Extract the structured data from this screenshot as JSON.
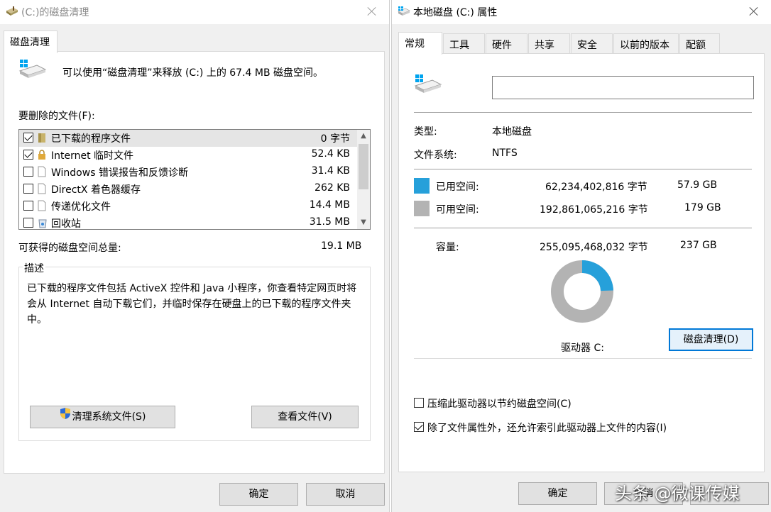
{
  "left": {
    "title": "(C:)的磁盘清理",
    "tab": "磁盘清理",
    "summary": "可以使用“磁盘清理”来释放  (C:) 上的 67.4 MB 磁盘空间。",
    "files_label": "要删除的文件(F):",
    "files": [
      {
        "name": "已下载的程序文件",
        "size": "0 字节",
        "checked": true,
        "icon": "folder-icon"
      },
      {
        "name": "Internet 临时文件",
        "size": "52.4 KB",
        "checked": true,
        "icon": "lock-icon"
      },
      {
        "name": "Windows 错误报告和反馈诊断",
        "size": "31.4 KB",
        "checked": false,
        "icon": "file-icon"
      },
      {
        "name": "DirectX 着色器缓存",
        "size": "262 KB",
        "checked": false,
        "icon": "file-icon"
      },
      {
        "name": "传递优化文件",
        "size": "14.4 MB",
        "checked": false,
        "icon": "file-icon"
      },
      {
        "name": "回收站",
        "size": "31.5 MB",
        "checked": false,
        "icon": "recycle-bin-icon"
      }
    ],
    "total_label": "可获得的磁盘空间总量:",
    "total_value": "19.1 MB",
    "description_title": "描述",
    "description": "已下载的程序文件包括 ActiveX 控件和 Java 小程序，你查看特定网页时将会从 Internet 自动下载它们，并临时保存在硬盘上的已下载的程序文件夹中。",
    "clean_system_label": "清理系统文件(S)",
    "view_files_label": "查看文件(V)",
    "ok_label": "确定",
    "cancel_label": "取消"
  },
  "right": {
    "title": "本地磁盘 (C:) 属性",
    "tabs": [
      "常规",
      "工具",
      "硬件",
      "共享",
      "安全",
      "以前的版本",
      "配额"
    ],
    "volume_name": "",
    "type_label": "类型:",
    "type_value": "本地磁盘",
    "fs_label": "文件系统:",
    "fs_value": "NTFS",
    "used_label": "已用空间:",
    "used_bytes": "62,234,402,816 字节",
    "used_gb": "57.9 GB",
    "free_label": "可用空间:",
    "free_bytes": "192,861,065,216 字节",
    "free_gb": "179 GB",
    "capacity_label": "容量:",
    "capacity_bytes": "255,095,468,032 字节",
    "capacity_gb": "237 GB",
    "drive_label": "驱动器 C:",
    "cleanup_label": "磁盘清理(D)",
    "compress_label": "压缩此驱动器以节约磁盘空间(C)",
    "compress_checked": false,
    "index_label": "除了文件属性外，还允许索引此驱动器上文件的内容(I)",
    "index_checked": true,
    "ok_label": "确定",
    "cancel_label": "取消",
    "used_fraction": 0.244,
    "colors": {
      "used": "#26a0da",
      "free": "#b3b3b3"
    }
  },
  "watermark": "头条 @微课传媒"
}
